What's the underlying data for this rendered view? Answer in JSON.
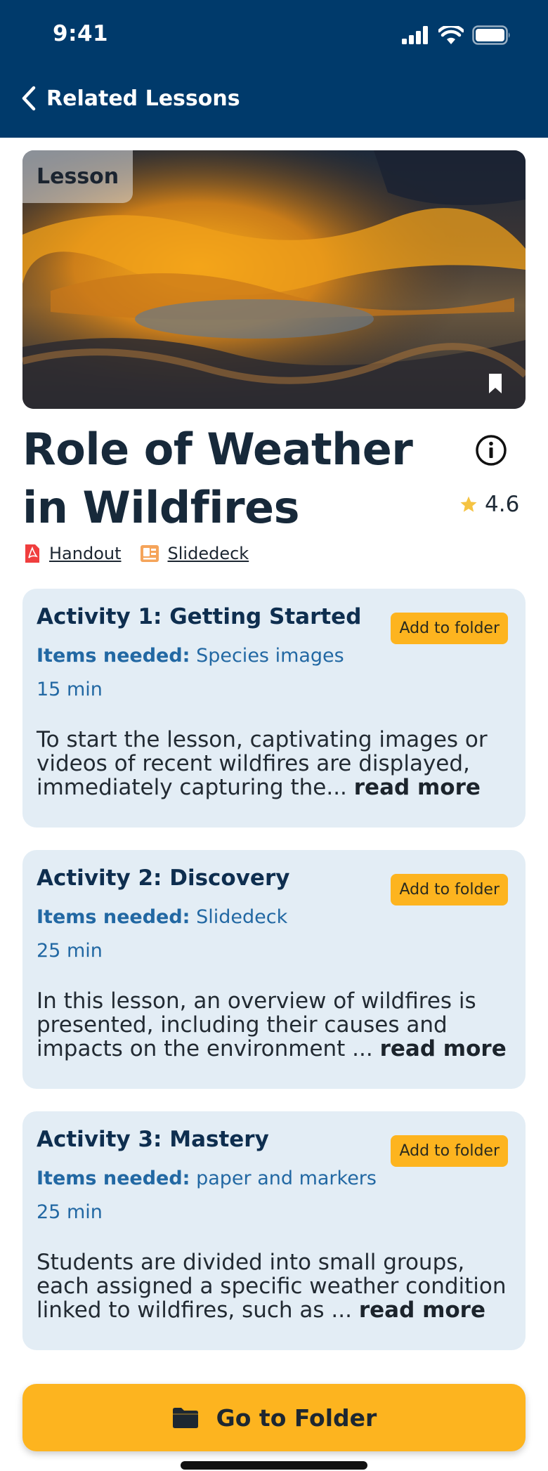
{
  "status_bar": {
    "time": "9:41"
  },
  "nav": {
    "title": "Related Lessons"
  },
  "hero": {
    "badge": "Lesson"
  },
  "lesson": {
    "title": "Role of Weather in Wildfires",
    "rating": "4.6"
  },
  "resources": [
    {
      "label": "Handout",
      "icon": "pdf-icon"
    },
    {
      "label": "Slidedeck",
      "icon": "slides-icon"
    }
  ],
  "activities": [
    {
      "title": "Activity 1: Getting Started",
      "add_label": "Add to folder",
      "items_label": "Items needed:",
      "items_value": "Species images",
      "duration": "15 min",
      "description": "To start the lesson, captivating images or videos of recent wildfires are displayed, immediately capturing the...",
      "more": "read more"
    },
    {
      "title": "Activity 2: Discovery",
      "add_label": "Add to folder",
      "items_label": "Items needed:",
      "items_value": "Slidedeck",
      "duration": "25 min",
      "description": "In this lesson, an overview of wildfires is presented, including their causes and impacts on the environment ...",
      "more": "read more"
    },
    {
      "title": "Activity 3: Mastery",
      "add_label": "Add to folder",
      "items_label": "Items needed:",
      "items_value": "paper and markers",
      "duration": "25 min",
      "description": "Students are divided into small groups, each assigned a specific weather condition linked to wildfires, such as ...",
      "more": "read more"
    }
  ],
  "footer": {
    "button_label": "Go to Folder"
  },
  "colors": {
    "header": "#003A6B",
    "accent": "#FDB41F",
    "card": "#E3EDF5",
    "link": "#2268A3"
  }
}
